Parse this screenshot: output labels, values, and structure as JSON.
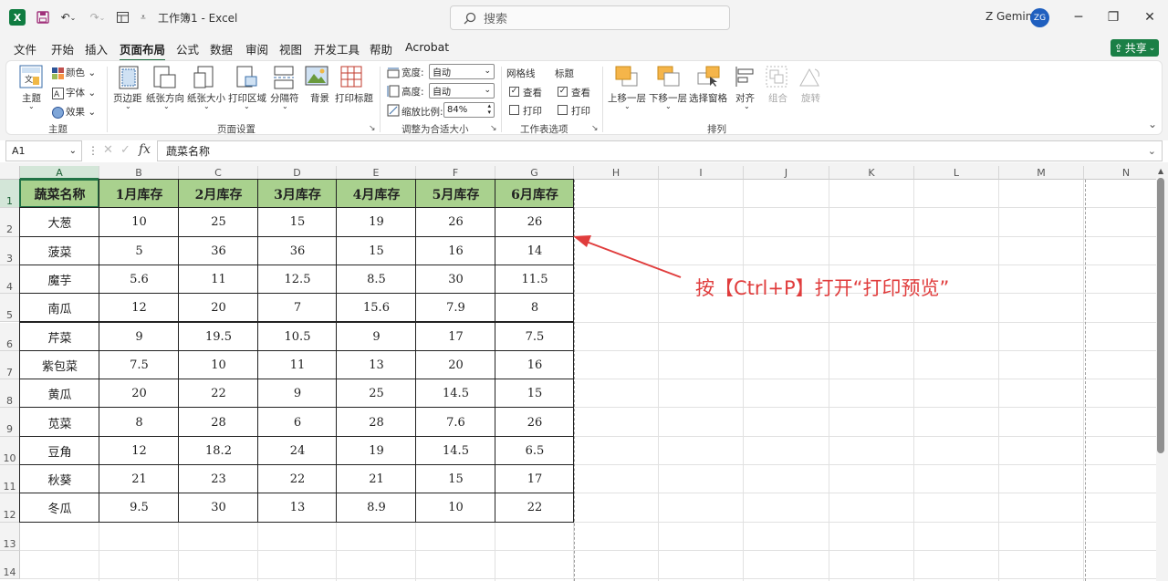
{
  "titlebar": {
    "app_icon": "X",
    "doc_title": "工作簿1 - Excel",
    "search_placeholder": "搜索",
    "user_name": "Z Gemini",
    "avatar_initials": "ZG",
    "minimize": "─",
    "restore": "❐",
    "close": "✕"
  },
  "menu": {
    "items": [
      "文件",
      "开始",
      "插入",
      "页面布局",
      "公式",
      "数据",
      "审阅",
      "视图",
      "开发工具",
      "帮助",
      "Acrobat"
    ],
    "active": "页面布局",
    "share": "共享"
  },
  "ribbon": {
    "theme_group": {
      "themes": "主题",
      "colors": "颜色",
      "fonts": "字体",
      "effects": "效果",
      "label": "主题"
    },
    "page_setup_group": {
      "margins": "页边距",
      "orientation": "纸张方向",
      "size": "纸张大小",
      "print_area": "打印区域",
      "breaks": "分隔符",
      "background": "背景",
      "print_titles": "打印标题",
      "label": "页面设置"
    },
    "scale_group": {
      "width_label": "宽度:",
      "width_value": "自动",
      "height_label": "高度:",
      "height_value": "自动",
      "scale_label": "缩放比例:",
      "scale_value": "84%",
      "label": "调整为合适大小"
    },
    "sheet_options_group": {
      "gridlines": "网格线",
      "headings": "标题",
      "view": "查看",
      "print": "打印",
      "label": "工作表选项"
    },
    "arrange_group": {
      "bring_forward": "上移一层",
      "send_backward": "下移一层",
      "selection_pane": "选择窗格",
      "align": "对齐",
      "group": "组合",
      "rotate": "旋转",
      "label": "排列"
    }
  },
  "formula_bar": {
    "name_box": "A1",
    "fx": "fx",
    "content": "蔬菜名称"
  },
  "sheet": {
    "columns": [
      "A",
      "B",
      "C",
      "D",
      "E",
      "F",
      "G",
      "H",
      "I",
      "J",
      "K",
      "L",
      "M",
      "N"
    ],
    "rows": [
      "1",
      "2",
      "3",
      "4",
      "5",
      "6",
      "7",
      "8",
      "9",
      "10",
      "11",
      "12",
      "13",
      "14"
    ],
    "header": [
      "蔬菜名称",
      "1月库存",
      "2月库存",
      "3月库存",
      "4月库存",
      "5月库存",
      "6月库存"
    ],
    "data": [
      [
        "大葱",
        "10",
        "25",
        "15",
        "19",
        "26",
        "26"
      ],
      [
        "菠菜",
        "5",
        "36",
        "36",
        "15",
        "16",
        "14"
      ],
      [
        "魔芋",
        "5.6",
        "11",
        "12.5",
        "8.5",
        "30",
        "11.5"
      ],
      [
        "南瓜",
        "12",
        "20",
        "7",
        "15.6",
        "7.9",
        "8"
      ],
      [
        "芹菜",
        "9",
        "19.5",
        "10.5",
        "9",
        "17",
        "7.5"
      ],
      [
        "紫包菜",
        "7.5",
        "10",
        "11",
        "13",
        "20",
        "16"
      ],
      [
        "黄瓜",
        "20",
        "22",
        "9",
        "25",
        "14.5",
        "15"
      ],
      [
        "苋菜",
        "8",
        "28",
        "6",
        "28",
        "7.6",
        "26"
      ],
      [
        "豆角",
        "12",
        "18.2",
        "24",
        "19",
        "14.5",
        "6.5"
      ],
      [
        "秋葵",
        "21",
        "23",
        "22",
        "21",
        "15",
        "17"
      ],
      [
        "冬瓜",
        "9.5",
        "30",
        "13",
        "8.9",
        "10",
        "22"
      ]
    ]
  },
  "annotation": "按【Ctrl+P】打开“打印预览”",
  "colors": {
    "excel_green": "#107c41",
    "header_fill": "#a9d18e",
    "annotation_red": "#e03c3c"
  }
}
